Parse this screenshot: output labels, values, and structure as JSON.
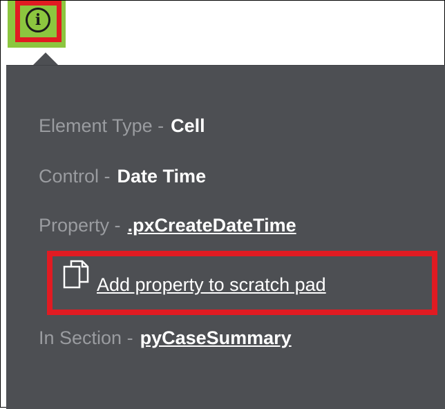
{
  "info_button": {
    "icon": "info-icon",
    "glyph": "i",
    "tab_color": "#8cc63f",
    "highlight_color": "#e11b22"
  },
  "popover": {
    "background": "#4d4f53",
    "element_type": {
      "label": "Element Type -",
      "value": "Cell"
    },
    "control": {
      "label": "Control -",
      "value": "Date Time"
    },
    "property": {
      "label": "Property -",
      "value": ".pxCreateDateTime"
    },
    "scratch_pad": {
      "icon": "copy-icon",
      "label": "Add property to scratch pad"
    },
    "section": {
      "label": "In Section -",
      "value": "pyCaseSummary"
    }
  }
}
